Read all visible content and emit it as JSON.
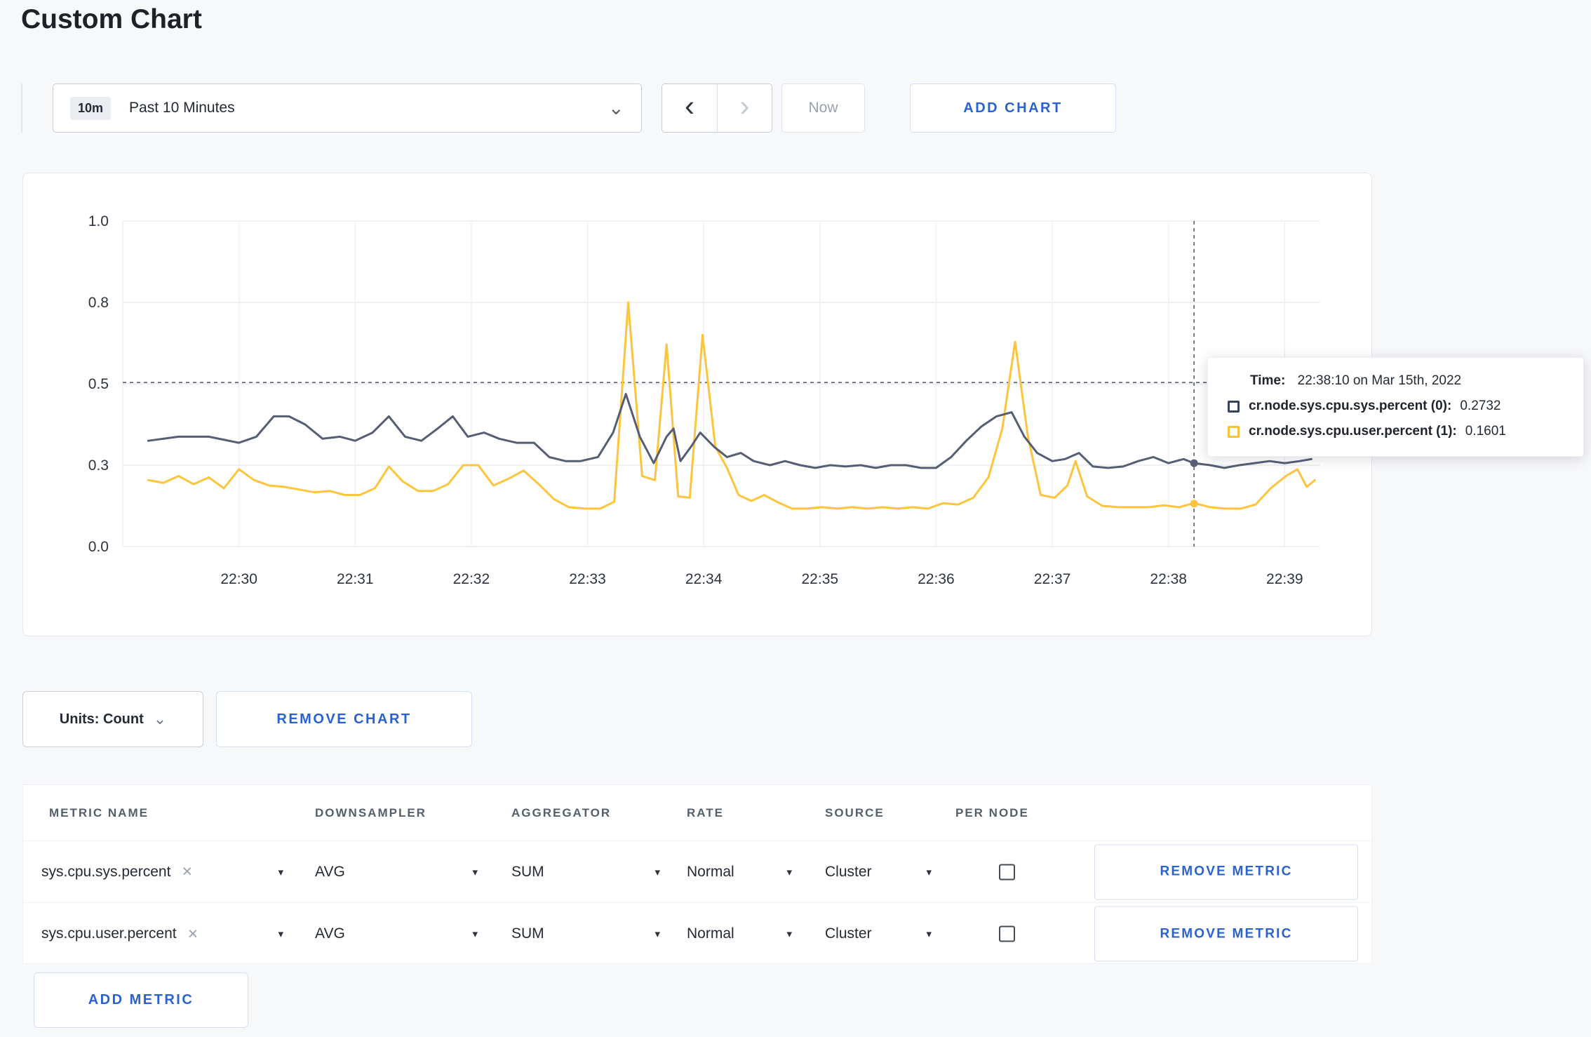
{
  "page": {
    "title": "Custom Chart"
  },
  "theme": {
    "accent": "#2a63d0",
    "background": "#f7f8fa",
    "card": "#ffffff"
  },
  "icons": {
    "chevron_down": "⌄",
    "chevron_left": "‹",
    "chevron_right": "›",
    "clear": "×",
    "caret": "▾"
  },
  "toolbar": {
    "time_window_badge": "10m",
    "time_window_label": "Past 10 Minutes",
    "now_label": "Now",
    "add_chart_label": "ADD CHART"
  },
  "chart_controls": {
    "units_label": "Units: Count",
    "remove_chart_label": "REMOVE CHART"
  },
  "tooltip": {
    "time_label": "Time:",
    "time_value": "22:38:10 on Mar 15th, 2022",
    "series": [
      {
        "label": "cr.node.sys.cpu.sys.percent (0):",
        "value": "0.2732",
        "color": "#39425c"
      },
      {
        "label": "cr.node.sys.cpu.user.percent (1):",
        "value": "0.1601",
        "color": "#fdc136"
      }
    ]
  },
  "metrics_table": {
    "headers": [
      "METRIC NAME",
      "DOWNSAMPLER",
      "AGGREGATOR",
      "RATE",
      "SOURCE",
      "PER NODE"
    ],
    "remove_metric_label": "REMOVE METRIC",
    "add_metric_label": "ADD METRIC",
    "rows": [
      {
        "metric": "sys.cpu.sys.percent",
        "downsampler": "AVG",
        "aggregator": "SUM",
        "rate": "Normal",
        "source": "Cluster",
        "per_node": false
      },
      {
        "metric": "sys.cpu.user.percent",
        "downsampler": "AVG",
        "aggregator": "SUM",
        "rate": "Normal",
        "source": "Cluster",
        "per_node": false
      }
    ]
  },
  "chart_data": {
    "type": "line",
    "title": "",
    "xlabel": "",
    "ylabel": "",
    "grid": true,
    "x_range": [
      29.0,
      39.3
    ],
    "ylim": [
      0,
      1.0
    ],
    "x_ticks": [
      {
        "value": 30,
        "label": "22:30"
      },
      {
        "value": 31,
        "label": "22:31"
      },
      {
        "value": 32,
        "label": "22:32"
      },
      {
        "value": 33,
        "label": "22:33"
      },
      {
        "value": 34,
        "label": "22:34"
      },
      {
        "value": 35,
        "label": "22:35"
      },
      {
        "value": 36,
        "label": "22:36"
      },
      {
        "value": 37,
        "label": "22:37"
      },
      {
        "value": 38,
        "label": "22:38"
      },
      {
        "value": 39,
        "label": "22:39"
      }
    ],
    "y_ticks": [
      {
        "value": 0.0,
        "label": "0.0"
      },
      {
        "value": 0.3,
        "label": "0.3"
      },
      {
        "value": 0.5,
        "label": "0.5"
      },
      {
        "value": 0.8,
        "label": "0.8"
      },
      {
        "value": 1.0,
        "label": "1.0"
      }
    ],
    "crosshair": {
      "x": 38.22,
      "y": 0.505
    },
    "colors": {
      "grid": "#e9ecef",
      "grid_vertical": "#eff1f4",
      "crosshair": "#4a5366",
      "axis_text": "#2e343d"
    },
    "series": [
      {
        "name": "cr.node.sys.cpu.sys.percent",
        "color": "#555e72",
        "marker": [
          38.22,
          0.305
        ],
        "points": [
          [
            29.22,
            0.36
          ],
          [
            29.48,
            0.37
          ],
          [
            29.74,
            0.37
          ],
          [
            30.0,
            0.355
          ],
          [
            30.15,
            0.37
          ],
          [
            30.3,
            0.42
          ],
          [
            30.43,
            0.42
          ],
          [
            30.57,
            0.4
          ],
          [
            30.72,
            0.365
          ],
          [
            30.87,
            0.37
          ],
          [
            31.0,
            0.36
          ],
          [
            31.15,
            0.38
          ],
          [
            31.29,
            0.42
          ],
          [
            31.43,
            0.37
          ],
          [
            31.57,
            0.36
          ],
          [
            31.71,
            0.39
          ],
          [
            31.84,
            0.42
          ],
          [
            31.97,
            0.37
          ],
          [
            32.11,
            0.38
          ],
          [
            32.24,
            0.365
          ],
          [
            32.39,
            0.355
          ],
          [
            32.54,
            0.355
          ],
          [
            32.67,
            0.32
          ],
          [
            32.81,
            0.31
          ],
          [
            32.94,
            0.31
          ],
          [
            33.09,
            0.32
          ],
          [
            33.22,
            0.38
          ],
          [
            33.33,
            0.475
          ],
          [
            33.45,
            0.37
          ],
          [
            33.57,
            0.305
          ],
          [
            33.68,
            0.37
          ],
          [
            33.74,
            0.39
          ],
          [
            33.8,
            0.31
          ],
          [
            33.89,
            0.345
          ],
          [
            33.97,
            0.38
          ],
          [
            34.09,
            0.345
          ],
          [
            34.2,
            0.32
          ],
          [
            34.32,
            0.33
          ],
          [
            34.43,
            0.31
          ],
          [
            34.57,
            0.3
          ],
          [
            34.7,
            0.31
          ],
          [
            34.83,
            0.3
          ],
          [
            34.96,
            0.29
          ],
          [
            35.09,
            0.3
          ],
          [
            35.22,
            0.295
          ],
          [
            35.35,
            0.3
          ],
          [
            35.48,
            0.29
          ],
          [
            35.61,
            0.3
          ],
          [
            35.74,
            0.3
          ],
          [
            35.87,
            0.29
          ],
          [
            36.0,
            0.29
          ],
          [
            36.13,
            0.32
          ],
          [
            36.26,
            0.36
          ],
          [
            36.39,
            0.395
          ],
          [
            36.52,
            0.42
          ],
          [
            36.65,
            0.43
          ],
          [
            36.76,
            0.37
          ],
          [
            36.87,
            0.33
          ],
          [
            37.0,
            0.31
          ],
          [
            37.11,
            0.315
          ],
          [
            37.23,
            0.33
          ],
          [
            37.35,
            0.295
          ],
          [
            37.48,
            0.29
          ],
          [
            37.61,
            0.295
          ],
          [
            37.74,
            0.31
          ],
          [
            37.87,
            0.32
          ],
          [
            38.0,
            0.305
          ],
          [
            38.13,
            0.315
          ],
          [
            38.22,
            0.305
          ],
          [
            38.36,
            0.3
          ],
          [
            38.48,
            0.29
          ],
          [
            38.61,
            0.3
          ],
          [
            38.74,
            0.305
          ],
          [
            38.87,
            0.31
          ],
          [
            39.0,
            0.305
          ],
          [
            39.13,
            0.31
          ],
          [
            39.23,
            0.315
          ]
        ]
      },
      {
        "name": "cr.node.sys.cpu.user.percent",
        "color": "#fcc53d",
        "marker": [
          38.22,
          0.158
        ],
        "points": [
          [
            29.22,
            0.245
          ],
          [
            29.35,
            0.235
          ],
          [
            29.48,
            0.26
          ],
          [
            29.61,
            0.23
          ],
          [
            29.74,
            0.255
          ],
          [
            29.87,
            0.215
          ],
          [
            30.0,
            0.285
          ],
          [
            30.13,
            0.245
          ],
          [
            30.26,
            0.225
          ],
          [
            30.39,
            0.22
          ],
          [
            30.52,
            0.21
          ],
          [
            30.65,
            0.2
          ],
          [
            30.78,
            0.205
          ],
          [
            30.91,
            0.19
          ],
          [
            31.04,
            0.19
          ],
          [
            31.17,
            0.215
          ],
          [
            31.29,
            0.295
          ],
          [
            31.41,
            0.24
          ],
          [
            31.54,
            0.205
          ],
          [
            31.67,
            0.205
          ],
          [
            31.8,
            0.23
          ],
          [
            31.93,
            0.3
          ],
          [
            32.06,
            0.3
          ],
          [
            32.19,
            0.225
          ],
          [
            32.32,
            0.25
          ],
          [
            32.45,
            0.28
          ],
          [
            32.58,
            0.23
          ],
          [
            32.71,
            0.175
          ],
          [
            32.84,
            0.145
          ],
          [
            32.98,
            0.14
          ],
          [
            33.11,
            0.14
          ],
          [
            33.23,
            0.165
          ],
          [
            33.35,
            0.8
          ],
          [
            33.47,
            0.26
          ],
          [
            33.58,
            0.245
          ],
          [
            33.68,
            0.645
          ],
          [
            33.78,
            0.185
          ],
          [
            33.88,
            0.18
          ],
          [
            33.99,
            0.68
          ],
          [
            34.1,
            0.345
          ],
          [
            34.2,
            0.29
          ],
          [
            34.3,
            0.19
          ],
          [
            34.41,
            0.168
          ],
          [
            34.52,
            0.19
          ],
          [
            34.63,
            0.165
          ],
          [
            34.76,
            0.14
          ],
          [
            34.89,
            0.14
          ],
          [
            35.02,
            0.145
          ],
          [
            35.15,
            0.14
          ],
          [
            35.28,
            0.145
          ],
          [
            35.41,
            0.14
          ],
          [
            35.54,
            0.145
          ],
          [
            35.67,
            0.14
          ],
          [
            35.8,
            0.145
          ],
          [
            35.93,
            0.14
          ],
          [
            36.06,
            0.16
          ],
          [
            36.19,
            0.155
          ],
          [
            36.32,
            0.18
          ],
          [
            36.45,
            0.255
          ],
          [
            36.57,
            0.39
          ],
          [
            36.68,
            0.655
          ],
          [
            36.79,
            0.37
          ],
          [
            36.9,
            0.19
          ],
          [
            37.02,
            0.18
          ],
          [
            37.13,
            0.225
          ],
          [
            37.2,
            0.31
          ],
          [
            37.3,
            0.185
          ],
          [
            37.43,
            0.15
          ],
          [
            37.57,
            0.145
          ],
          [
            37.7,
            0.145
          ],
          [
            37.83,
            0.145
          ],
          [
            37.96,
            0.152
          ],
          [
            38.09,
            0.145
          ],
          [
            38.22,
            0.16
          ],
          [
            38.36,
            0.145
          ],
          [
            38.49,
            0.14
          ],
          [
            38.62,
            0.14
          ],
          [
            38.75,
            0.155
          ],
          [
            38.88,
            0.215
          ],
          [
            39.01,
            0.26
          ],
          [
            39.11,
            0.285
          ],
          [
            39.19,
            0.22
          ],
          [
            39.26,
            0.245
          ]
        ]
      }
    ]
  }
}
